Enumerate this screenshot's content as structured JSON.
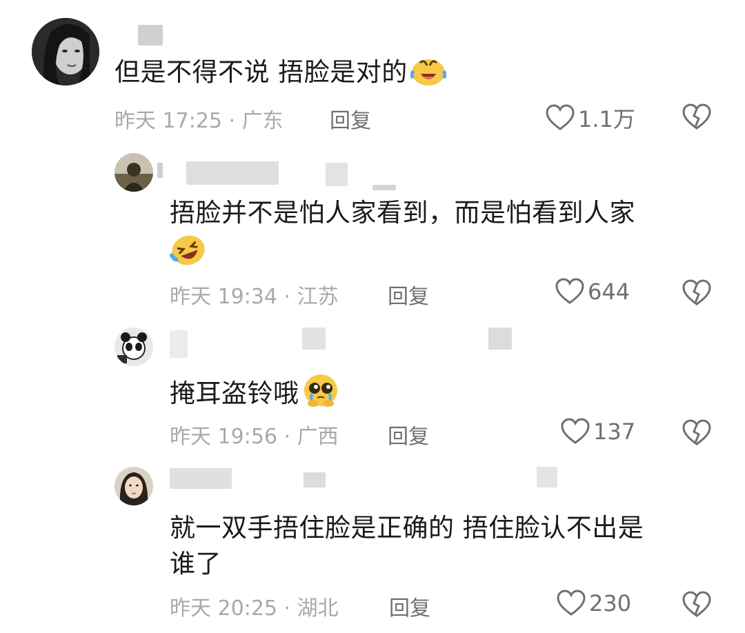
{
  "comments": [
    {
      "text": "但是不得不说  捂脸是对的",
      "emoji": "laughing-crying-emoji",
      "meta": "昨天 17:25 · 广东",
      "reply": "回复",
      "likes": "1.1万"
    },
    {
      "text_line1": "捂脸并不是怕人家看到，而是怕看到人家",
      "emoji": "rolling-laughing-emoji",
      "meta": "昨天 19:34 · 江苏",
      "reply": "回复",
      "likes": "644"
    },
    {
      "text": "掩耳盗铃哦",
      "emoji": "pleading-face-emoji",
      "meta": "昨天 19:56 · 广西",
      "reply": "回复",
      "likes": "137"
    },
    {
      "text_line1": "就一双手捂住脸是正确的 捂住脸认不出是",
      "text_line2": "谁了",
      "meta": "昨天 20:25 · 湖北",
      "reply": "回复",
      "likes": "230"
    }
  ],
  "icons": {
    "like": "heart-outline-icon",
    "dislike": "broken-heart-icon"
  }
}
